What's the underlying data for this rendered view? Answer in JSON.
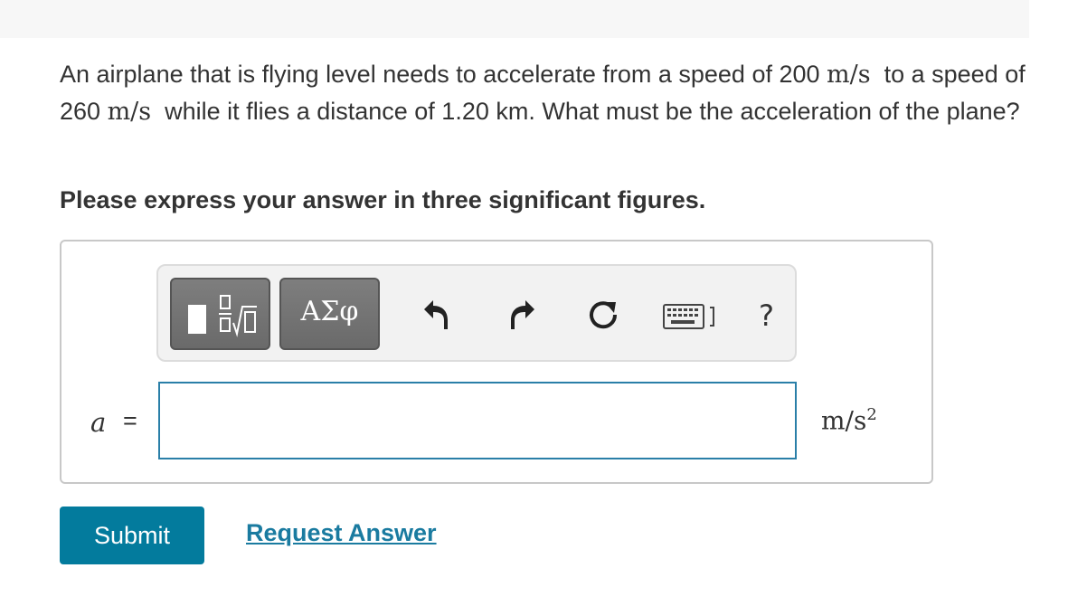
{
  "question": {
    "text_part1": "An airplane that is flying level needs to accelerate from a speed of 200",
    "unit1": "m/s",
    "text_part2": "to a speed of 260",
    "unit2": "m/s",
    "text_part3": "while it flies a distance of 1.20 km.  What must be the acceleration of the plane?"
  },
  "instruction": "Please express your answer in three significant figures.",
  "toolbar": {
    "template_button": "template-icon",
    "symbols_label": "ΑΣφ",
    "undo": "undo-icon",
    "redo": "redo-icon",
    "reset": "reset-icon",
    "keyboard": "keyboard-icon",
    "help_label": "?"
  },
  "answer": {
    "variable": "a",
    "equals": "=",
    "value": "",
    "placeholder": "",
    "unit_base": "m/s",
    "unit_exp": "2"
  },
  "actions": {
    "submit_label": "Submit",
    "request_label": "Request Answer"
  },
  "colors": {
    "accent": "#037b9d",
    "link": "#1a7ba0",
    "input_border": "#2a7fa8"
  }
}
